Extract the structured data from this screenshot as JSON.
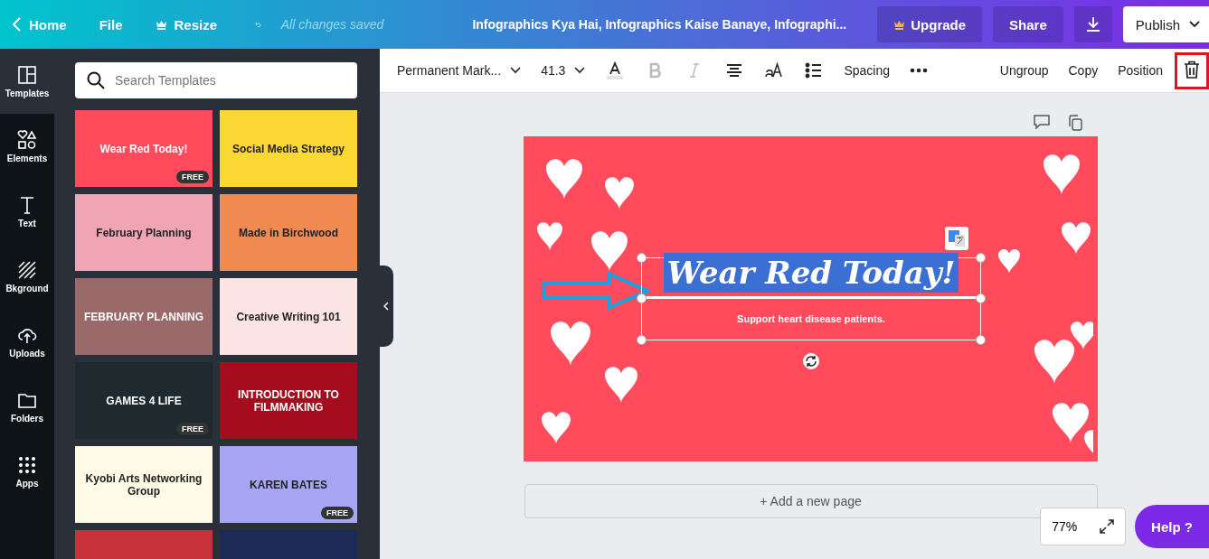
{
  "topbar": {
    "nav": [
      {
        "kind": "back",
        "label": "Home"
      },
      {
        "kind": "plain",
        "label": "File"
      },
      {
        "kind": "crown",
        "label": "Resize"
      }
    ],
    "save_status": "All changes saved",
    "title": "Infographics Kya Hai, Infographics Kaise Banaye, Infographi...",
    "upgrade": "Upgrade",
    "share": "Share",
    "publish": "Publish"
  },
  "rail": [
    {
      "label": "Templates",
      "selected": true
    },
    {
      "label": "Elements",
      "selected": false
    },
    {
      "label": "Text",
      "selected": false
    },
    {
      "label": "Bkground",
      "selected": false
    },
    {
      "label": "Uploads",
      "selected": false
    },
    {
      "label": "Folders",
      "selected": false
    },
    {
      "label": "Apps",
      "selected": false
    }
  ],
  "search": {
    "placeholder": "Search Templates"
  },
  "templates": [
    {
      "title": "Wear Red Today!",
      "color": "#ff4b5c",
      "badge": "FREE"
    },
    {
      "title": "Social Media Strategy",
      "color": "#fdd835"
    },
    {
      "title": "February Planning",
      "color": "#f1a4b4"
    },
    {
      "title": "Made in Birchwood",
      "color": "#f08a50"
    },
    {
      "title": "FEBRUARY PLANNING",
      "color": "#9a6a6a"
    },
    {
      "title": "Creative Writing 101",
      "color": "#fde4e4"
    },
    {
      "title": "GAMES 4 LIFE",
      "color": "#1e2a2e",
      "badge": "FREE"
    },
    {
      "title": "INTRODUCTION TO FILMMAKING",
      "color": "#a50d1e"
    },
    {
      "title": "Kyobi Arts Networking Group",
      "color": "#fefbe6"
    },
    {
      "title": "KAREN BATES",
      "color": "#a7a6f5",
      "badge": "FREE"
    },
    {
      "color": "#c8323a"
    },
    {
      "color": "#1c2a55"
    }
  ],
  "toolbar": {
    "font": "Permanent Mark...",
    "size": "41.3",
    "tools": [
      {
        "kind": "color",
        "disabled": false
      },
      {
        "kind": "bold",
        "disabled": true
      },
      {
        "kind": "italic",
        "disabled": true
      },
      {
        "kind": "align",
        "disabled": false
      },
      {
        "kind": "case",
        "disabled": false
      },
      {
        "kind": "list",
        "disabled": false
      }
    ],
    "spacing": "Spacing",
    "actions": [
      "Ungroup",
      "Copy",
      "Position"
    ],
    "delete_highlighted": true
  },
  "page": {
    "heading": "Wear Red Today!",
    "subtitle": "Support heart disease patients.",
    "heading_selected": true
  },
  "add_page": "+ Add a new page",
  "zoom": "77%",
  "help": "Help ?"
}
